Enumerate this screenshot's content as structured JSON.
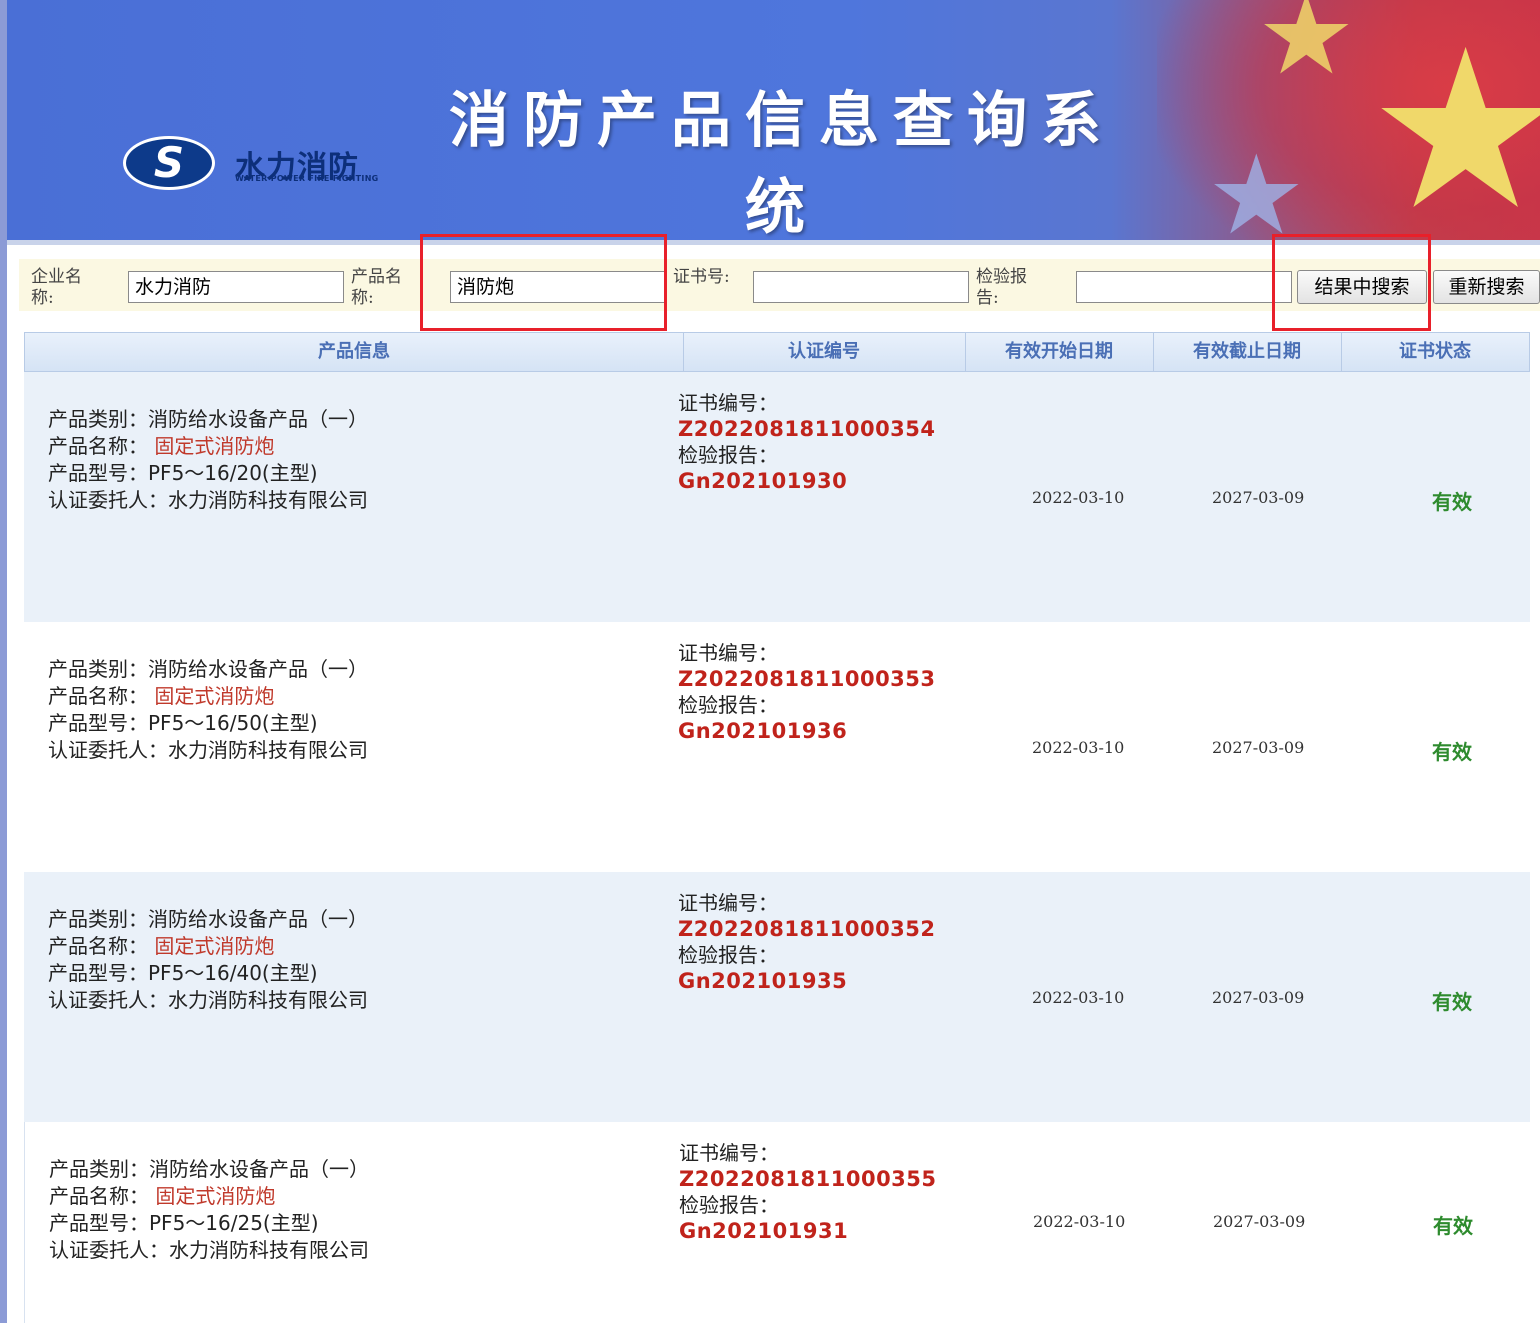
{
  "header": {
    "title": "消防产品信息查询系统",
    "logo_name": "水力消防",
    "logo_sub": "WATER POWER FIRE FIGHTING",
    "logo_mark": "S"
  },
  "search": {
    "company_label": "企业名称:",
    "company_value": "水力消防",
    "product_label": "产品名称:",
    "product_value": "消防炮",
    "cert_label": "证书号:",
    "cert_value": "",
    "report_label": "检验报告:",
    "report_value": "",
    "search_in_results": "结果中搜索",
    "new_search": "重新搜索"
  },
  "annotations": {
    "box1": "1",
    "box2": "2"
  },
  "table": {
    "headers": [
      "产品信息",
      "认证编号",
      "有效开始日期",
      "有效截止日期",
      "证书状态"
    ],
    "rows": [
      {
        "category_label": "产品类别：",
        "category": "消防给水设备产品（一）",
        "name_label": "产品名称：",
        "name": "固定式消防炮",
        "model_label": "产品型号：",
        "model": "PF5～16/20(主型)",
        "client_label": "认证委托人：",
        "client": "水力消防科技有限公司",
        "cert_label": "证书编号：",
        "cert_no": "Z2022081811000354",
        "report_label": "检验报告：",
        "report_no": "Gn202101930",
        "start": "2022-03-10",
        "end": "2027-03-09",
        "status": "有效"
      },
      {
        "category_label": "产品类别：",
        "category": "消防给水设备产品（一）",
        "name_label": "产品名称：",
        "name": "固定式消防炮",
        "model_label": "产品型号：",
        "model": "PF5～16/50(主型)",
        "client_label": "认证委托人：",
        "client": "水力消防科技有限公司",
        "cert_label": "证书编号：",
        "cert_no": "Z2022081811000353",
        "report_label": "检验报告：",
        "report_no": "Gn202101936",
        "start": "2022-03-10",
        "end": "2027-03-09",
        "status": "有效"
      },
      {
        "category_label": "产品类别：",
        "category": "消防给水设备产品（一）",
        "name_label": "产品名称：",
        "name": "固定式消防炮",
        "model_label": "产品型号：",
        "model": "PF5～16/40(主型)",
        "client_label": "认证委托人：",
        "client": "水力消防科技有限公司",
        "cert_label": "证书编号：",
        "cert_no": "Z2022081811000352",
        "report_label": "检验报告：",
        "report_no": "Gn202101935",
        "start": "2022-03-10",
        "end": "2027-03-09",
        "status": "有效"
      },
      {
        "category_label": "产品类别：",
        "category": "消防给水设备产品（一）",
        "name_label": "产品名称：",
        "name": "固定式消防炮",
        "model_label": "产品型号：",
        "model": "PF5～16/25(主型)",
        "client_label": "认证委托人：",
        "client": "水力消防科技有限公司",
        "cert_label": "证书编号：",
        "cert_no": "Z2022081811000355",
        "report_label": "检验报告：",
        "report_no": "Gn202101931",
        "start": "2022-03-10",
        "end": "2027-03-09",
        "status": "有效"
      }
    ]
  },
  "colors": {
    "banner_blue": "#4f76dc",
    "flag_red": "#c8384a",
    "code_red": "#c0231b",
    "status_green": "#2e8b2e",
    "header_text": "#4a6fb5",
    "row_alt": "#eaf1f9",
    "annotation_red": "#e8202a"
  }
}
